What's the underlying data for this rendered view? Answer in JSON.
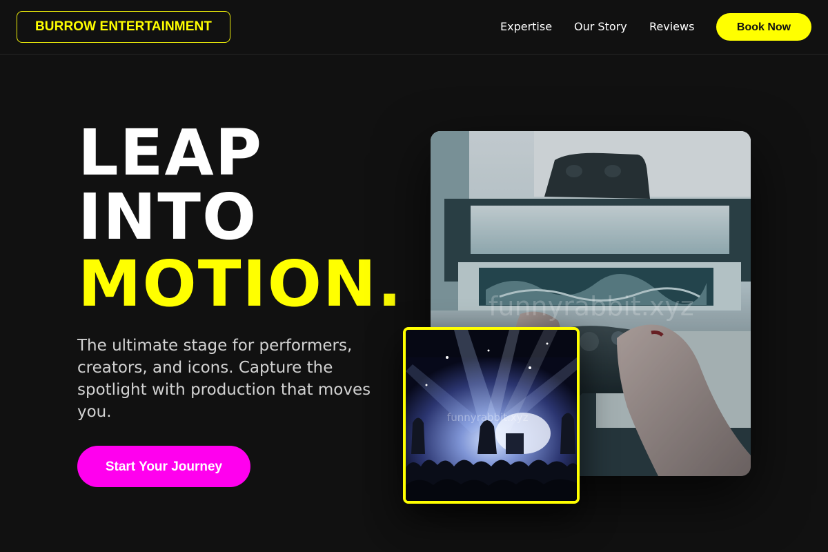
{
  "header": {
    "brand": "BURROW ENTERTAINMENT",
    "nav": [
      {
        "label": "Expertise"
      },
      {
        "label": "Our Story"
      },
      {
        "label": "Reviews"
      }
    ],
    "cta_label": "Book Now"
  },
  "hero": {
    "headline_lines": [
      "LEAP",
      "INTO",
      "MOTION."
    ],
    "subtext": "The ultimate stage for performers, creators, and icons. Capture the spotlight with production that moves you.",
    "cta_label": "Start Your Journey"
  },
  "images": {
    "main_watermark": "funnyrabbit.xyz",
    "inset_watermark": "funnyrabbit.xyz"
  },
  "colors": {
    "background": "#111111",
    "accent_yellow": "#ffff00",
    "accent_magenta": "#ff00ee",
    "text_white": "#ffffff",
    "text_muted": "#d2d2d2"
  },
  "icons": []
}
